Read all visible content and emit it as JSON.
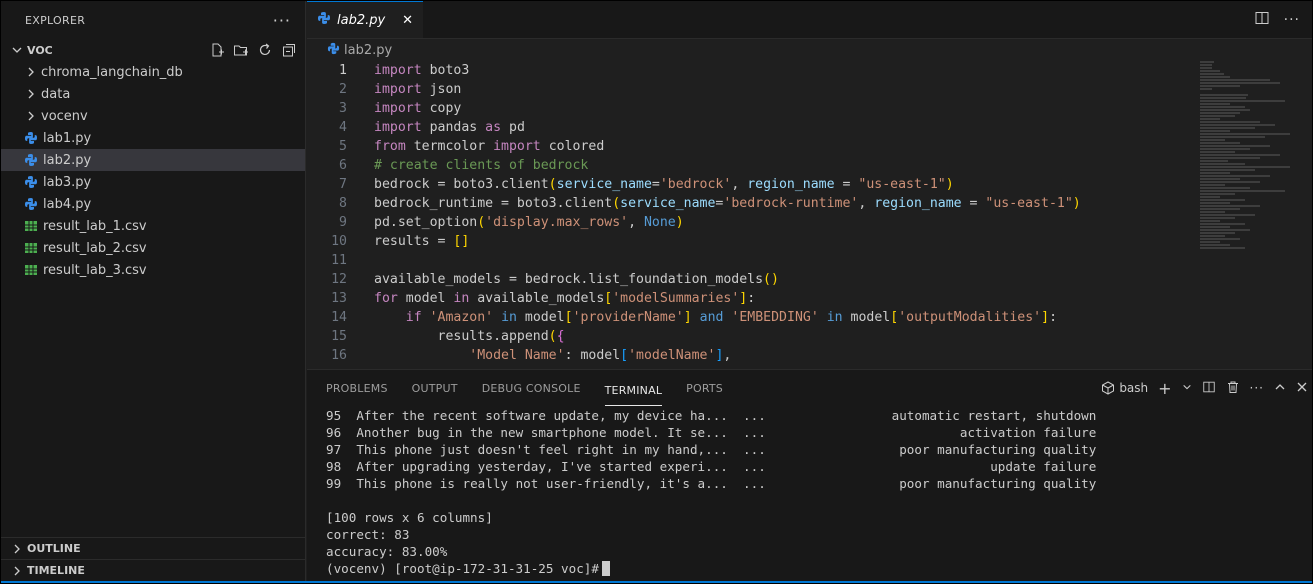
{
  "sidebar": {
    "title": "EXPLORER",
    "more": "···",
    "folder": "VOC",
    "items": [
      {
        "label": "chroma_langchain_db",
        "type": "folder"
      },
      {
        "label": "data",
        "type": "folder"
      },
      {
        "label": "vocenv",
        "type": "folder"
      },
      {
        "label": "lab1.py",
        "type": "python"
      },
      {
        "label": "lab2.py",
        "type": "python",
        "selected": true
      },
      {
        "label": "lab3.py",
        "type": "python"
      },
      {
        "label": "lab4.py",
        "type": "python"
      },
      {
        "label": "result_lab_1.csv",
        "type": "csv"
      },
      {
        "label": "result_lab_2.csv",
        "type": "csv"
      },
      {
        "label": "result_lab_3.csv",
        "type": "csv"
      }
    ],
    "outline": "OUTLINE",
    "timeline": "TIMELINE"
  },
  "editor": {
    "tab": "lab2.py",
    "tab_close": "✕",
    "breadcrumb": "lab2.py",
    "line_numbers": [
      "1",
      "2",
      "3",
      "4",
      "5",
      "6",
      "7",
      "8",
      "9",
      "10",
      "11",
      "12",
      "13",
      "14",
      "15",
      "16"
    ]
  },
  "panel": {
    "tabs": [
      "PROBLEMS",
      "OUTPUT",
      "DEBUG CONSOLE",
      "TERMINAL",
      "PORTS"
    ],
    "active_tab": "TERMINAL",
    "shell": "bash",
    "rows": [
      {
        "idx": "95",
        "text": "After the recent software update, my device ha...  ...",
        "result": "automatic restart, shutdown"
      },
      {
        "idx": "96",
        "text": "Another bug in the new smartphone model. It se...  ...",
        "result": "activation failure"
      },
      {
        "idx": "97",
        "text": "This phone just doesn't feel right in my hand,...  ...",
        "result": "poor manufacturing quality"
      },
      {
        "idx": "98",
        "text": "After upgrading yesterday, I've started experi...  ...",
        "result": "update failure"
      },
      {
        "idx": "99",
        "text": "This phone is really not user-friendly, it's a...  ...",
        "result": "poor manufacturing quality"
      }
    ],
    "summary": "[100 rows x 6 columns]",
    "correct": "correct: 83",
    "accuracy": "accuracy: 83.00%",
    "prompt": "(vocenv) [root@ip-172-31-31-25 voc]#"
  },
  "colors": {
    "accent": "#0078d4",
    "python_icon": "#3b8eea",
    "csv_icon": "#4caf50"
  }
}
